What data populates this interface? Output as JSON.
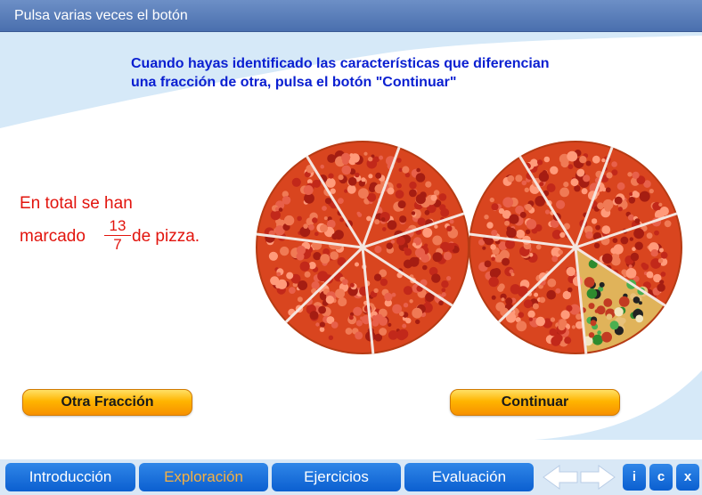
{
  "header": {
    "title": "Pulsa varias veces el botón"
  },
  "instruction": {
    "line1": "Cuando hayas identificado las características que diferencian",
    "line2": "una fracción de otra, pulsa el botón \"Continuar\""
  },
  "result": {
    "line1": "En total se han",
    "prefix": "marcado",
    "numerator": "13",
    "denominator": "7",
    "suffix": "de pizza."
  },
  "pizzas": {
    "slices_per_pizza": 7,
    "marked_slices": 13,
    "unmarked_slices_in_second": 1
  },
  "buttons": {
    "other_fraction": "Otra Fracción",
    "continue": "Continuar"
  },
  "nav": {
    "tabs": [
      "Introducción",
      "Exploración",
      "Ejercicios",
      "Evaluación"
    ],
    "active_tab": "Exploración",
    "small_buttons": [
      "i",
      "c",
      "x"
    ]
  },
  "colors": {
    "title_bar": "#5a7fbf",
    "instruction_text": "#0a1fd1",
    "result_text": "#e2140d",
    "button_orange": "#ffb400",
    "nav_blue": "#1a6fdc",
    "active_tab_text": "#f5b042"
  }
}
